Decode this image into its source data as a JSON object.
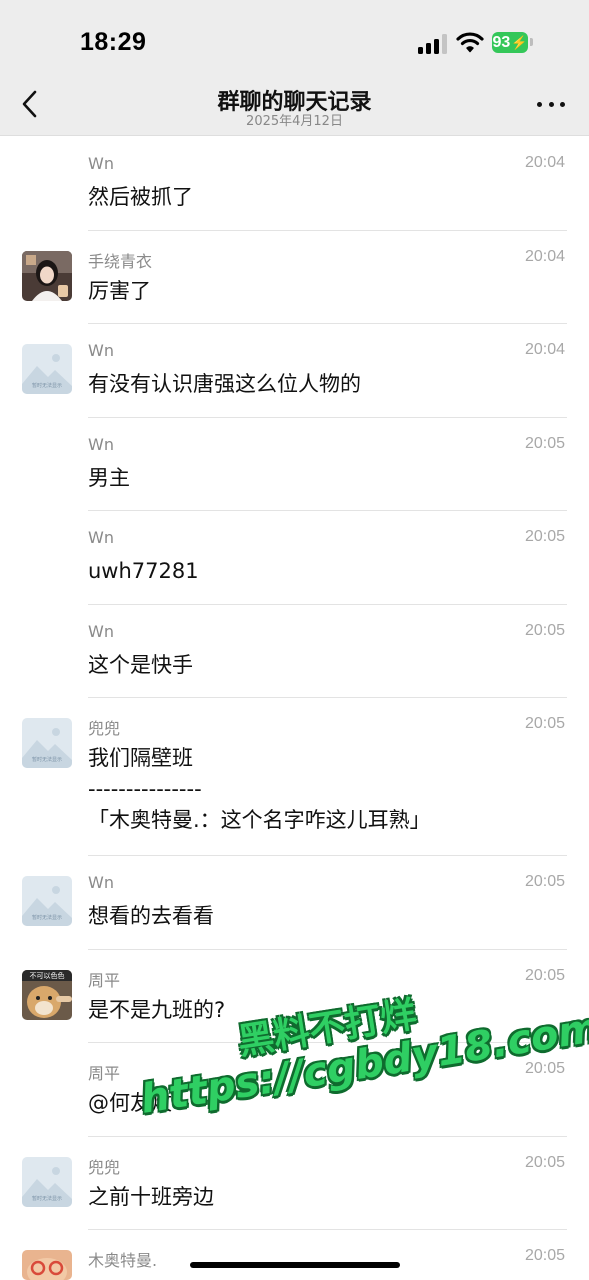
{
  "status_bar": {
    "time": "18:29",
    "battery": "93"
  },
  "header": {
    "title": "群聊的聊天记录",
    "date": "2025年4月12日"
  },
  "messages": [
    {
      "sender": "Wn",
      "time": "20:04",
      "text": "然后被抓了"
    },
    {
      "sender": "手绕青衣",
      "time": "20:04",
      "text": "厉害了"
    },
    {
      "sender": "Wn",
      "time": "20:04",
      "text": "有没有认识唐强这么位人物的"
    },
    {
      "sender": "Wn",
      "time": "20:05",
      "text": "男主"
    },
    {
      "sender": "Wn",
      "time": "20:05",
      "text": "uwh77281"
    },
    {
      "sender": "Wn",
      "time": "20:05",
      "text": "这个是快手"
    },
    {
      "sender": "兜兜",
      "time": "20:05",
      "text": "我们隔壁班",
      "separator": "---------------",
      "quote": "「木奥特曼.：这个名字咋这儿耳熟」"
    },
    {
      "sender": "Wn",
      "time": "20:05",
      "text": "想看的去看看"
    },
    {
      "sender": "周平",
      "time": "20:05",
      "text": "是不是九班的?"
    },
    {
      "sender": "周平",
      "time": "20:05",
      "text": "@何友炆"
    },
    {
      "sender": "兜兜",
      "time": "20:05",
      "text": "之前十班旁边"
    },
    {
      "sender": "木奥特曼.",
      "time": "20:05",
      "text": ""
    }
  ],
  "avatar_captions": {
    "placeholder": "暂时无法显示",
    "zhouping": "不可以色色"
  },
  "watermark": {
    "line1": "黑料不打烊",
    "line2": "https://cgbdy18.com"
  },
  "colors": {
    "battery": "#34c759",
    "watermark": "#2fcf63"
  }
}
